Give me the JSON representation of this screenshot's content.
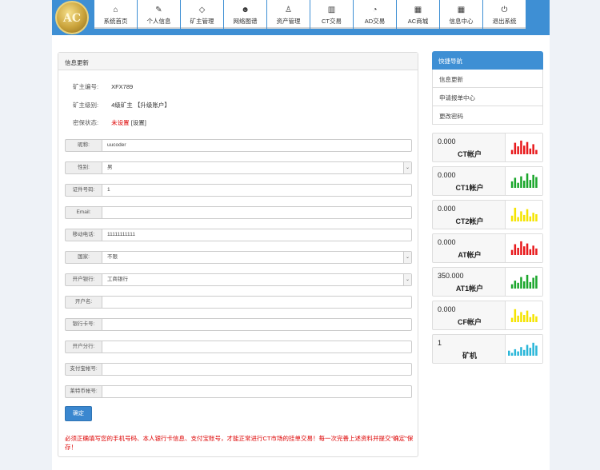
{
  "brand": {
    "logo_text": "AC"
  },
  "nav": [
    {
      "icon": "home-icon",
      "glyph": "⌂",
      "label": "系统首页"
    },
    {
      "icon": "edit-icon",
      "glyph": "✎",
      "label": "个人信息"
    },
    {
      "icon": "diamond-icon",
      "glyph": "◇",
      "label": "矿主管理"
    },
    {
      "icon": "users-icon",
      "glyph": "☻",
      "label": "网络图谱"
    },
    {
      "icon": "user-icon",
      "glyph": "♙",
      "label": "资产管理"
    },
    {
      "icon": "bar-chart-icon",
      "glyph": "▥",
      "label": "CT交易"
    },
    {
      "icon": "dashboard-icon",
      "glyph": "◔",
      "label": "AD交易"
    },
    {
      "icon": "calendar-icon",
      "glyph": "▦",
      "label": "AC商城"
    },
    {
      "icon": "calendar-icon",
      "glyph": "▦",
      "label": "信息中心"
    },
    {
      "icon": "power-icon",
      "glyph": "⏻",
      "label": "退出系统"
    }
  ],
  "panel": {
    "title": "信息更新"
  },
  "info": {
    "id_label": "矿主编号:",
    "id_value": "XFX789",
    "level_label": "矿主级别:",
    "level_value": "4级矿主 【升级账户】",
    "guarantee_label": "密保状态:",
    "guarantee_value": "未设置",
    "guarantee_link": "[设置]"
  },
  "form": [
    {
      "label": "昵称:",
      "value": "uucoder",
      "select": false
    },
    {
      "label": "性别:",
      "value": "男",
      "select": true
    },
    {
      "label": "证件号码:",
      "value": "1",
      "select": false
    },
    {
      "label": "Email:",
      "value": "",
      "select": false
    },
    {
      "label": "移动电话:",
      "value": "11111111111",
      "select": false
    },
    {
      "label": "国家:",
      "value": "不限",
      "select": true
    },
    {
      "label": "开户银行:",
      "value": "工商银行",
      "select": true
    },
    {
      "label": "开户名:",
      "value": "",
      "select": false
    },
    {
      "label": "银行卡号:",
      "value": "",
      "select": false
    },
    {
      "label": "开户分行:",
      "value": "",
      "select": false
    },
    {
      "label": "支付宝帐号:",
      "value": "",
      "select": false
    },
    {
      "label": "莱特币帐号:",
      "value": "",
      "select": false
    }
  ],
  "submit_label": "确定",
  "warning": "必须正确填写您的手机号码、本人银行卡信息、支付宝账号，才能正常进行CT市场的挂单交易！每一次完善上述资料并提交\"确定\"保存！",
  "side": {
    "title": "快捷导航",
    "links": [
      "信息更新",
      "申请报单中心",
      "更改密码"
    ]
  },
  "accounts": [
    {
      "value": "0.000",
      "name": "CT帐户",
      "color": "#e8191c",
      "bars": [
        0.3,
        0.8,
        0.55,
        0.95,
        0.6,
        0.85,
        0.4,
        0.7,
        0.3
      ]
    },
    {
      "value": "0.000",
      "name": "CT1帐户",
      "color": "#1aa62b",
      "bars": [
        0.45,
        0.7,
        0.35,
        0.8,
        0.5,
        1.0,
        0.55,
        0.9,
        0.75
      ]
    },
    {
      "value": "0.000",
      "name": "CT2帐户",
      "color": "#f5e400",
      "bars": [
        0.4,
        0.95,
        0.3,
        0.7,
        0.45,
        0.85,
        0.35,
        0.6,
        0.5
      ]
    },
    {
      "value": "0.000",
      "name": "AT帐户",
      "color": "#e8191c",
      "bars": [
        0.35,
        0.75,
        0.5,
        0.95,
        0.6,
        0.8,
        0.4,
        0.65,
        0.45
      ]
    },
    {
      "value": "350.000",
      "name": "AT1帐户",
      "color": "#1aa62b",
      "bars": [
        0.3,
        0.55,
        0.4,
        0.8,
        0.5,
        0.95,
        0.45,
        0.75,
        0.9
      ]
    },
    {
      "value": "0.000",
      "name": "CF帐户",
      "color": "#f5e400",
      "bars": [
        0.3,
        0.9,
        0.45,
        0.7,
        0.5,
        0.8,
        0.35,
        0.55,
        0.4
      ]
    },
    {
      "value": "1",
      "name": "矿机",
      "color": "#29b6d8",
      "bars": [
        0.35,
        0.2,
        0.45,
        0.3,
        0.6,
        0.4,
        0.75,
        0.55,
        0.9,
        0.7
      ]
    }
  ]
}
